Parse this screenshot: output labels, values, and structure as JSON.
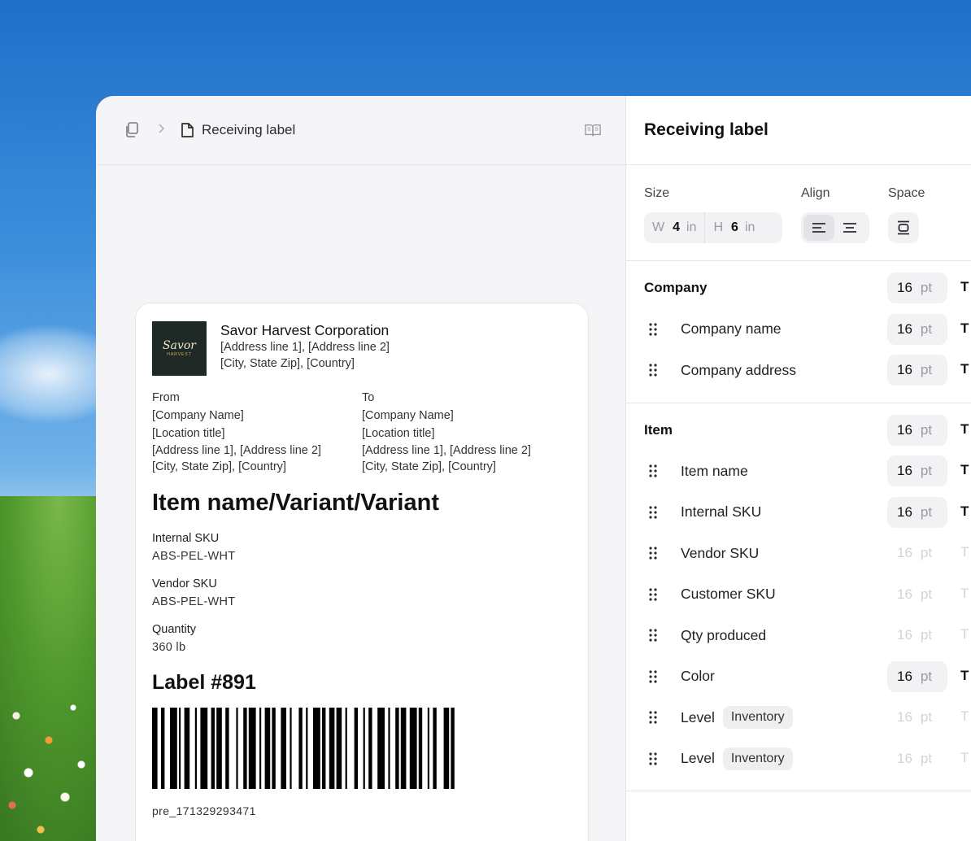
{
  "breadcrumb": {
    "title": "Receiving label"
  },
  "panel": {
    "title": "Receiving label"
  },
  "controls": {
    "size_label": "Size",
    "align_label": "Align",
    "space_label": "Space",
    "width_prefix": "W",
    "width_value": "4",
    "width_unit": "in",
    "height_prefix": "H",
    "height_value": "6",
    "height_unit": "in"
  },
  "label": {
    "company_name": "Savor Harvest Corporation",
    "company_addr1": "[Address line 1], [Address line 2]",
    "company_addr2": "[City, State Zip], [Country]",
    "logo_text": "Savor",
    "logo_sub": "HARVEST",
    "from": {
      "heading": "From",
      "company": "[Company Name]",
      "location": "[Location title]",
      "addr1": "[Address line 1], [Address line 2]",
      "addr2": "[City, State Zip], [Country]"
    },
    "to": {
      "heading": "To",
      "company": "[Company Name]",
      "location": "[Location title]",
      "addr1": "[Address line 1], [Address line 2]",
      "addr2": "[City, State Zip], [Country]"
    },
    "item_title": "Item name/Variant/Variant",
    "internal_sku_label": "Internal SKU",
    "internal_sku_value": "ABS-PEL-WHT",
    "vendor_sku_label": "Vendor SKU",
    "vendor_sku_value": "ABS-PEL-WHT",
    "quantity_label": "Quantity",
    "quantity_value": "360 lb",
    "label_number": "Label #891",
    "barcode_text": "pre_171329293471"
  },
  "sections": [
    {
      "heading": "Company",
      "heading_size": "16",
      "heading_unit": "pt",
      "heading_on": true,
      "rows": [
        {
          "label": "Company name",
          "size": "16",
          "unit": "pt",
          "on": true
        },
        {
          "label": "Company address",
          "size": "16",
          "unit": "pt",
          "on": true
        }
      ]
    },
    {
      "heading": "Item",
      "heading_size": "16",
      "heading_unit": "pt",
      "heading_on": true,
      "rows": [
        {
          "label": "Item name",
          "size": "16",
          "unit": "pt",
          "on": true
        },
        {
          "label": "Internal SKU",
          "size": "16",
          "unit": "pt",
          "on": true
        },
        {
          "label": "Vendor SKU",
          "size": "16",
          "unit": "pt",
          "on": false
        },
        {
          "label": "Customer SKU",
          "size": "16",
          "unit": "pt",
          "on": false
        },
        {
          "label": "Qty produced",
          "size": "16",
          "unit": "pt",
          "on": false
        },
        {
          "label": "Color",
          "size": "16",
          "unit": "pt",
          "on": true
        },
        {
          "label": "Level",
          "badge": "Inventory",
          "size": "16",
          "unit": "pt",
          "on": false
        },
        {
          "label": "Level",
          "badge": "Inventory",
          "size": "16",
          "unit": "pt",
          "on": false
        }
      ]
    }
  ],
  "t_glyph": "T"
}
